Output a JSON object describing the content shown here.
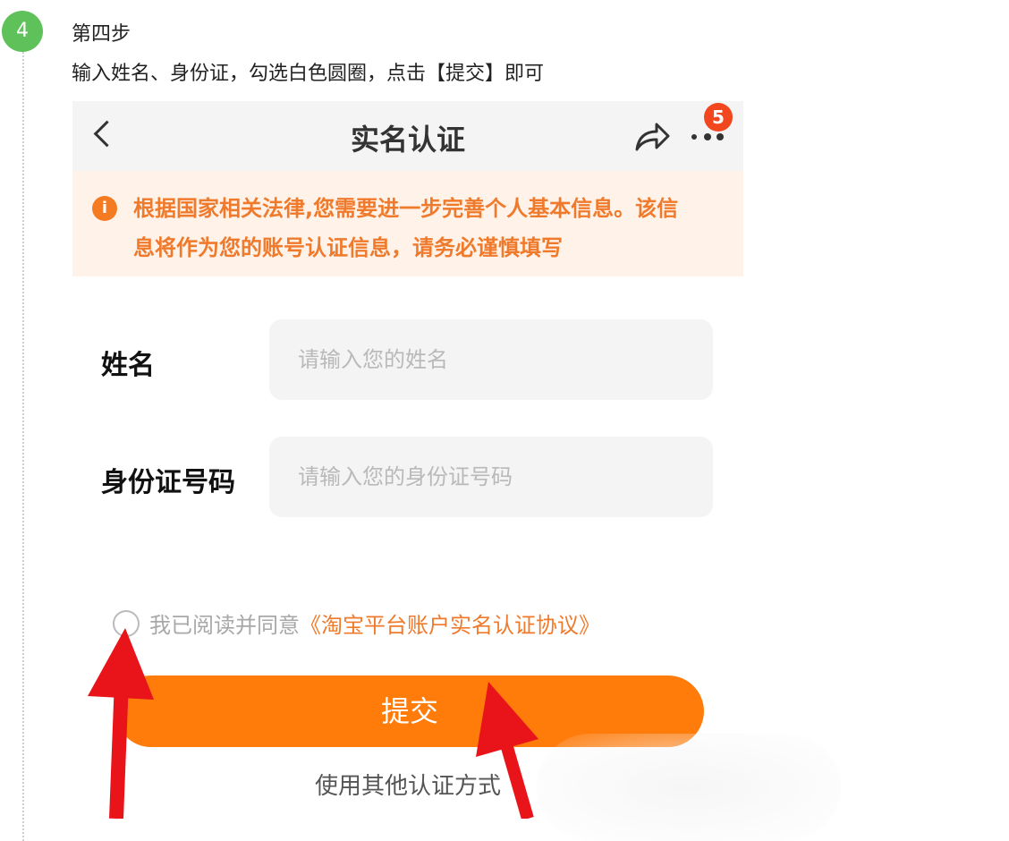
{
  "step": {
    "number": "4",
    "title": "第四步",
    "description": "输入姓名、身份证，勾选白色圆圈，点击【提交】即可"
  },
  "navbar": {
    "title": "实名认证",
    "badge_count": "5",
    "icons": [
      "back-icon",
      "share-icon",
      "more-icon"
    ]
  },
  "notice": {
    "icon": "i",
    "line1": "根据国家相关法律,您需要进一步完善个人基本信息。该信",
    "line2": "息将作为您的账号认证信息，请务必谨慎填写"
  },
  "form": {
    "name_label": "姓名",
    "name_placeholder": "请输入您的姓名",
    "id_label": "身份证号码",
    "id_placeholder": "请输入您的身份证号码"
  },
  "agreement": {
    "prefix": "我已阅读并同意",
    "link": "《淘宝平台账户实名认证协议》"
  },
  "submit_label": "提交",
  "alt_method_label": "使用其他认证方式",
  "colors": {
    "accent_orange": "#ff7b0a",
    "notice_bg": "#fff2e8",
    "step_green": "#5ec15a",
    "arrow_red": "#e8141a"
  }
}
